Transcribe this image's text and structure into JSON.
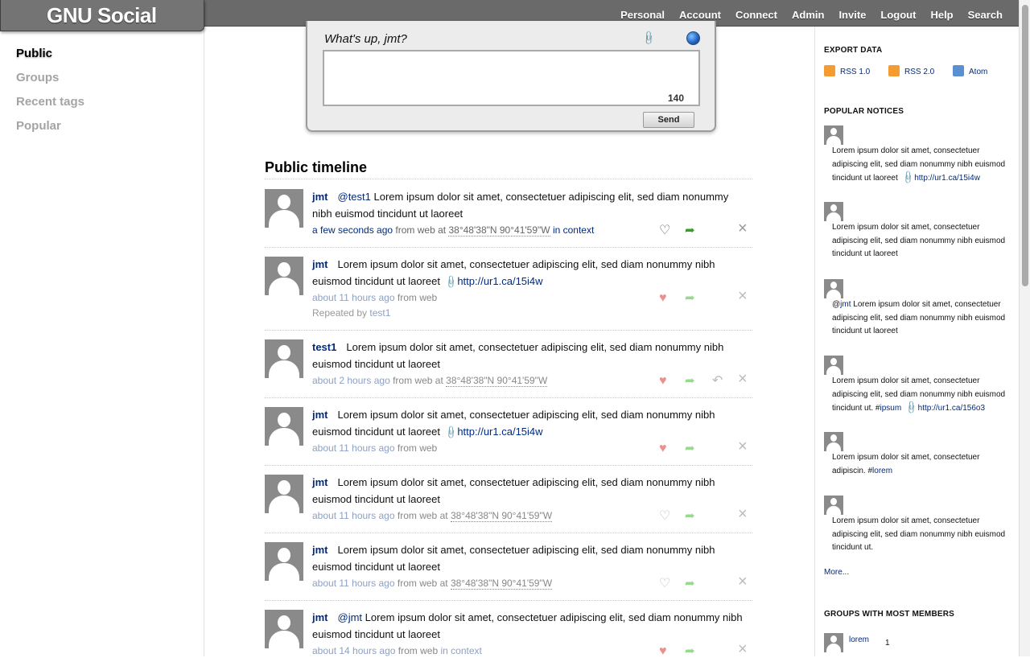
{
  "header": {
    "site_name": "GNU Social",
    "nav": [
      "Personal",
      "Account",
      "Connect",
      "Admin",
      "Invite",
      "Logout",
      "Help",
      "Search"
    ]
  },
  "left_nav": {
    "items": [
      {
        "label": "Public",
        "active": true
      },
      {
        "label": "Groups",
        "active": false
      },
      {
        "label": "Recent tags",
        "active": false
      },
      {
        "label": "Popular",
        "active": false
      }
    ]
  },
  "composer": {
    "prompt": "What's up, jmt?",
    "attach_icon": "paperclip-icon",
    "location_icon": "globe-icon",
    "counter": "140",
    "send_label": "Send"
  },
  "timeline": {
    "title": "Public timeline",
    "notices": [
      {
        "nick": "jmt",
        "mention": "@test1",
        "text": " Lorem ipsum dolor sit amet, consectetuer adipiscing elit, sed diam nonummy nibh euismod tincidunt ut laoreet",
        "link": "",
        "time": "a few seconds ago",
        "source": "from web",
        "at": "at",
        "geo": "38°48'38\"N 90°41'59\"W",
        "context": "in context",
        "repeated_by_label": "",
        "repeated_by": ""
      },
      {
        "nick": "jmt",
        "mention": "",
        "text": "Lorem ipsum dolor sit amet, consectetuer adipiscing elit, sed diam nonummy nibh euismod tincidunt ut laoreet",
        "link": "http://ur1.ca/15i4w",
        "time": "about 11 hours ago",
        "source": "from web",
        "at": "",
        "geo": "",
        "context": "",
        "repeated_by_label": "Repeated by",
        "repeated_by": "test1"
      },
      {
        "nick": "test1",
        "mention": "",
        "text": "Lorem ipsum dolor sit amet, consectetuer adipiscing elit, sed diam nonummy nibh euismod tincidunt ut laoreet",
        "link": "",
        "time": "about 2 hours ago",
        "source": "from web",
        "at": "at",
        "geo": "38°48'38\"N 90°41'59\"W",
        "context": "",
        "repeated_by_label": "",
        "repeated_by": ""
      },
      {
        "nick": "jmt",
        "mention": "",
        "text": "Lorem ipsum dolor sit amet, consectetuer adipiscing elit, sed diam nonummy nibh euismod tincidunt ut laoreet",
        "link": "http://ur1.ca/15i4w",
        "time": "about 11 hours ago",
        "source": "from web",
        "at": "",
        "geo": "",
        "context": "",
        "repeated_by_label": "",
        "repeated_by": ""
      },
      {
        "nick": "jmt",
        "mention": "",
        "text": "Lorem ipsum dolor sit amet, consectetuer adipiscing elit, sed diam nonummy nibh euismod tincidunt ut laoreet",
        "link": "",
        "time": "about 11 hours ago",
        "source": "from web",
        "at": "at",
        "geo": "38°48'38\"N 90°41'59\"W",
        "context": "",
        "repeated_by_label": "",
        "repeated_by": ""
      },
      {
        "nick": "jmt",
        "mention": "",
        "text": "Lorem ipsum dolor sit amet, consectetuer adipiscing elit, sed diam nonummy nibh euismod tincidunt ut laoreet",
        "link": "",
        "time": "about 11 hours ago",
        "source": "from web",
        "at": "at",
        "geo": "38°48'38\"N 90°41'59\"W",
        "context": "",
        "repeated_by_label": "",
        "repeated_by": ""
      },
      {
        "nick": "jmt",
        "mention": "@jmt",
        "text": " Lorem ipsum dolor sit amet, consectetuer adipiscing elit, sed diam nonummy nibh euismod tincidunt ut laoreet",
        "link": "",
        "time": "about 14 hours ago",
        "source": "from web",
        "at": "",
        "geo": "",
        "context": "in context",
        "repeated_by_label": "",
        "repeated_by": ""
      }
    ]
  },
  "sidebar": {
    "export_title": "EXPORT DATA",
    "feeds": [
      "RSS 1.0",
      "RSS 2.0",
      "Atom"
    ],
    "popular_title": "POPULAR NOTICES",
    "popular": [
      {
        "pre": "",
        "text": "Lorem ipsum dolor sit amet, consectetuer adipiscing elit, sed diam nonummy nibh euismod tincidunt ut laoreet",
        "tag": "",
        "link": "http://ur1.ca/15i4w"
      },
      {
        "pre": "",
        "text": "Lorem ipsum dolor sit amet, consectetuer adipiscing elit, sed diam nonummy nibh euismod tincidunt ut laoreet",
        "tag": "",
        "link": ""
      },
      {
        "pre": "jmt",
        "text": " Lorem ipsum dolor sit amet, consectetuer adipiscing elit, sed diam nonummy nibh euismod tincidunt ut laoreet",
        "tag": "",
        "link": ""
      },
      {
        "pre": "",
        "text": "Lorem ipsum dolor sit amet, consectetuer adipiscing elit, sed diam nonummy nibh euismod tincidunt ut. #",
        "tag": "ipsum",
        "link": "http://ur1.ca/156o3"
      },
      {
        "pre": "",
        "text": "Lorem ipsum dolor sit amet, consectetuer adipiscin. #",
        "tag": "lorem",
        "link": ""
      },
      {
        "pre": "",
        "text": "Lorem ipsum dolor sit amet, consectetuer adipiscing elit, sed diam nonummy nibh euismod tincidunt ut.",
        "tag": "",
        "link": ""
      }
    ],
    "more": "More...",
    "groups_title": "GROUPS WITH MOST MEMBERS",
    "groups": [
      {
        "name": "lorem",
        "count": "1"
      }
    ]
  }
}
